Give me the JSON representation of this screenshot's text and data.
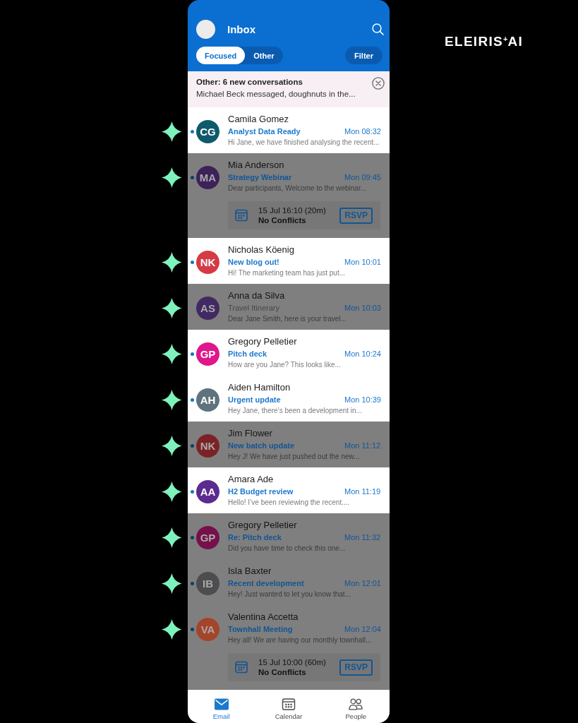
{
  "header": {
    "title": "Inbox",
    "tabs": [
      {
        "label": "Focused",
        "selected": true
      },
      {
        "label": "Other",
        "selected": false
      }
    ],
    "filter": "Filter"
  },
  "brand": "ELEIRIS$^{+}$AI",
  "banner": {
    "title": "Other: 6 new conversations",
    "text": "Michael Beck messaged, doughnuts in the..."
  },
  "emails": [
    {
      "sender": "Camila Gomez",
      "initials": "CG",
      "color": "#0e5a6c",
      "subject": "Analyst Data Ready",
      "time": "Mon 08:32",
      "preview": "Hi Jane, we have finished analysing the recent...",
      "unread": true,
      "dimmed": false
    },
    {
      "sender": "Mia Anderson",
      "initials": "MA",
      "color": "#3d2159",
      "subject": "Strategy Webinar",
      "time": "Mon 09:45",
      "preview": "Dear participants, Welcome to the webinar...",
      "unread": true,
      "dimmed": true,
      "event": {
        "when": "15 Jul 16:10 (20m)",
        "status": "No Conflicts",
        "action": "RSVP"
      }
    },
    {
      "sender": "Nicholas Köenig",
      "initials": "NK",
      "color": "#d63a46",
      "subject": "New blog out!",
      "time": "Mon 10:01",
      "preview": "Hi! The marketing team has just put...",
      "unread": true,
      "dimmed": false
    },
    {
      "sender": "Anna da Silva",
      "initials": "AS",
      "color": "#412962",
      "subject": "Travel Itinerary",
      "time": "Mon 10:03",
      "preview": "Dear Jane Smith, here is your travel...",
      "unread": false,
      "dimmed": true
    },
    {
      "sender": "Gregory Pelletier",
      "initials": "GP",
      "color": "#e0168c",
      "subject": "Pitch deck",
      "time": "Mon 10:24",
      "preview": "How are you Jane? This looks like...",
      "unread": true,
      "dimmed": false
    },
    {
      "sender": "Aiden Hamilton",
      "initials": "AH",
      "color": "#5e737b",
      "subject": "Urgent update",
      "time": "Mon 10:39",
      "preview": "Hey Jane, there’s been a development in...",
      "unread": true,
      "dimmed": false
    },
    {
      "sender": "Jim Flower",
      "initials": "NK",
      "color": "#7c2226",
      "subject": "New batch update",
      "time": "Mon 11:12",
      "preview": "Hey J! We have just pushed out the new...",
      "unread": true,
      "dimmed": true
    },
    {
      "sender": "Amara Ade",
      "initials": "AA",
      "color": "#5b2b8f",
      "subject": "H2 Budget review",
      "time": "Mon 11:19",
      "preview": "Hello! I’ve been reviewing the recent....",
      "unread": true,
      "dimmed": false
    },
    {
      "sender": "Gregory Pelletier",
      "initials": "GP",
      "color": "#76104a",
      "subject": "Re: Pitch deck",
      "time": "Mon 11:32",
      "preview": "Did you have time to check this one...",
      "unread": true,
      "dimmed": true
    },
    {
      "sender": "Isla Baxter",
      "initials": "IB",
      "color": "#4d4d4f",
      "subject": "Recent development",
      "time": "Mon 12:01",
      "preview": "Hey! Just wanted to let you know that...",
      "unread": true,
      "dimmed": true
    },
    {
      "sender": "Valentina Accetta",
      "initials": "VA",
      "color": "#a4452a",
      "subject": "Townhall Meeting",
      "time": "Mon 12:04",
      "preview": "Hey all! We are having our monthly townhall...",
      "unread": true,
      "dimmed": true,
      "event": {
        "when": "15 Jul 10:00 (60m)",
        "status": "No Conflicts",
        "action": "RSVP"
      }
    }
  ],
  "nav": [
    {
      "label": "Email",
      "selected": true
    },
    {
      "label": "Calendar",
      "selected": false
    },
    {
      "label": "People",
      "selected": false
    }
  ]
}
